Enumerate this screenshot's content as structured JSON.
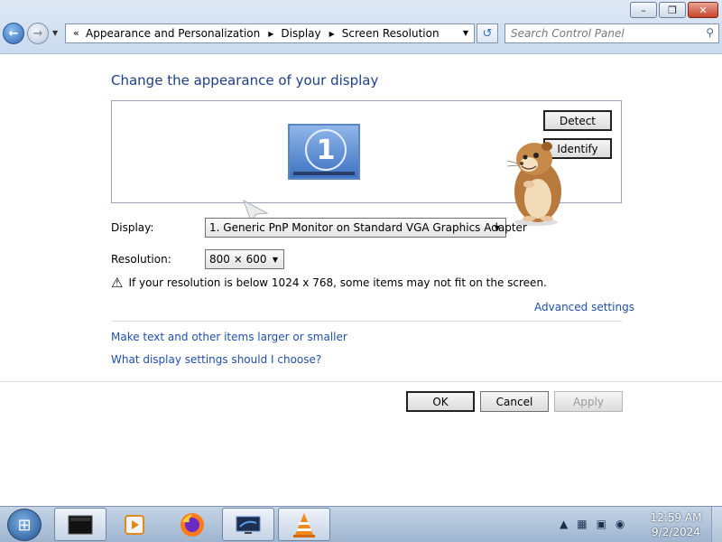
{
  "window": {
    "minimize": "–",
    "maximize": "❐",
    "close": "✕"
  },
  "nav": {
    "back": "←",
    "forward": "→"
  },
  "address": {
    "prefix": "«",
    "crumbs": [
      "Appearance and Personalization",
      "Display",
      "Screen Resolution"
    ]
  },
  "search": {
    "placeholder": "Search Control Panel"
  },
  "heading": "Change the appearance of your display",
  "preview": {
    "monitor_number": "1"
  },
  "buttons": {
    "detect": "Detect",
    "identify": "Identify",
    "ok": "OK",
    "cancel": "Cancel",
    "apply": "Apply"
  },
  "display": {
    "label": "Display:",
    "value": "1. Generic PnP Monitor on Standard VGA Graphics Adapter"
  },
  "resolution": {
    "label": "Resolution:",
    "value": "800 × 600"
  },
  "warning": "If your resolution is below 1024 x 768, some items may not fit on the screen.",
  "links": {
    "advanced": "Advanced settings",
    "text_size": "Make text and other items larger or smaller",
    "which_settings": "What display settings should I choose?"
  },
  "clock": {
    "time": "12:59 AM",
    "date": "9/2/2024"
  },
  "colors": {
    "heading": "#1e3f87",
    "link": "#1f4fa8"
  }
}
